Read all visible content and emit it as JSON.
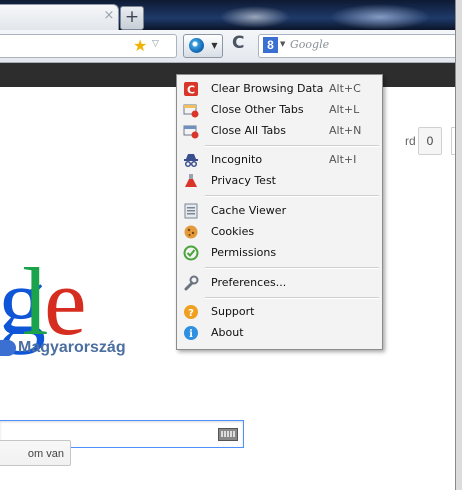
{
  "browser": {
    "new_tab_label": "+",
    "tab_close_label": "×",
    "search_placeholder": "Google",
    "search_engine_letter": "8"
  },
  "page": {
    "signin_partial": "rd",
    "count_value": "0",
    "country_label": "Magyarország",
    "lucky_button_partial": "om van",
    "logo_letters": [
      "g",
      "l",
      "e"
    ]
  },
  "menu": {
    "items": [
      {
        "label": "Clear Browsing Data",
        "shortcut": "Alt+C",
        "icon": "clear-data-icon"
      },
      {
        "label": "Close Other Tabs",
        "shortcut": "Alt+L",
        "icon": "close-other-tabs-icon"
      },
      {
        "label": "Close All Tabs",
        "shortcut": "Alt+N",
        "icon": "close-all-tabs-icon"
      },
      {
        "label": "Incognito",
        "shortcut": "Alt+I",
        "icon": "incognito-icon"
      },
      {
        "label": "Privacy Test",
        "shortcut": "",
        "icon": "flask-icon"
      },
      {
        "label": "Cache Viewer",
        "shortcut": "",
        "icon": "cache-viewer-icon"
      },
      {
        "label": "Cookies",
        "shortcut": "",
        "icon": "cookie-icon"
      },
      {
        "label": "Permissions",
        "shortcut": "",
        "icon": "checkmark-icon"
      },
      {
        "label": "Preferences...",
        "shortcut": "",
        "icon": "wrench-icon"
      },
      {
        "label": "Support",
        "shortcut": "",
        "icon": "help-icon"
      },
      {
        "label": "About",
        "shortcut": "",
        "icon": "info-icon"
      }
    ]
  },
  "colors": {
    "google_blue": "#0f55d8",
    "google_green": "#1aa34a",
    "google_red": "#d62d20",
    "menu_background": "#f3f3f3"
  }
}
